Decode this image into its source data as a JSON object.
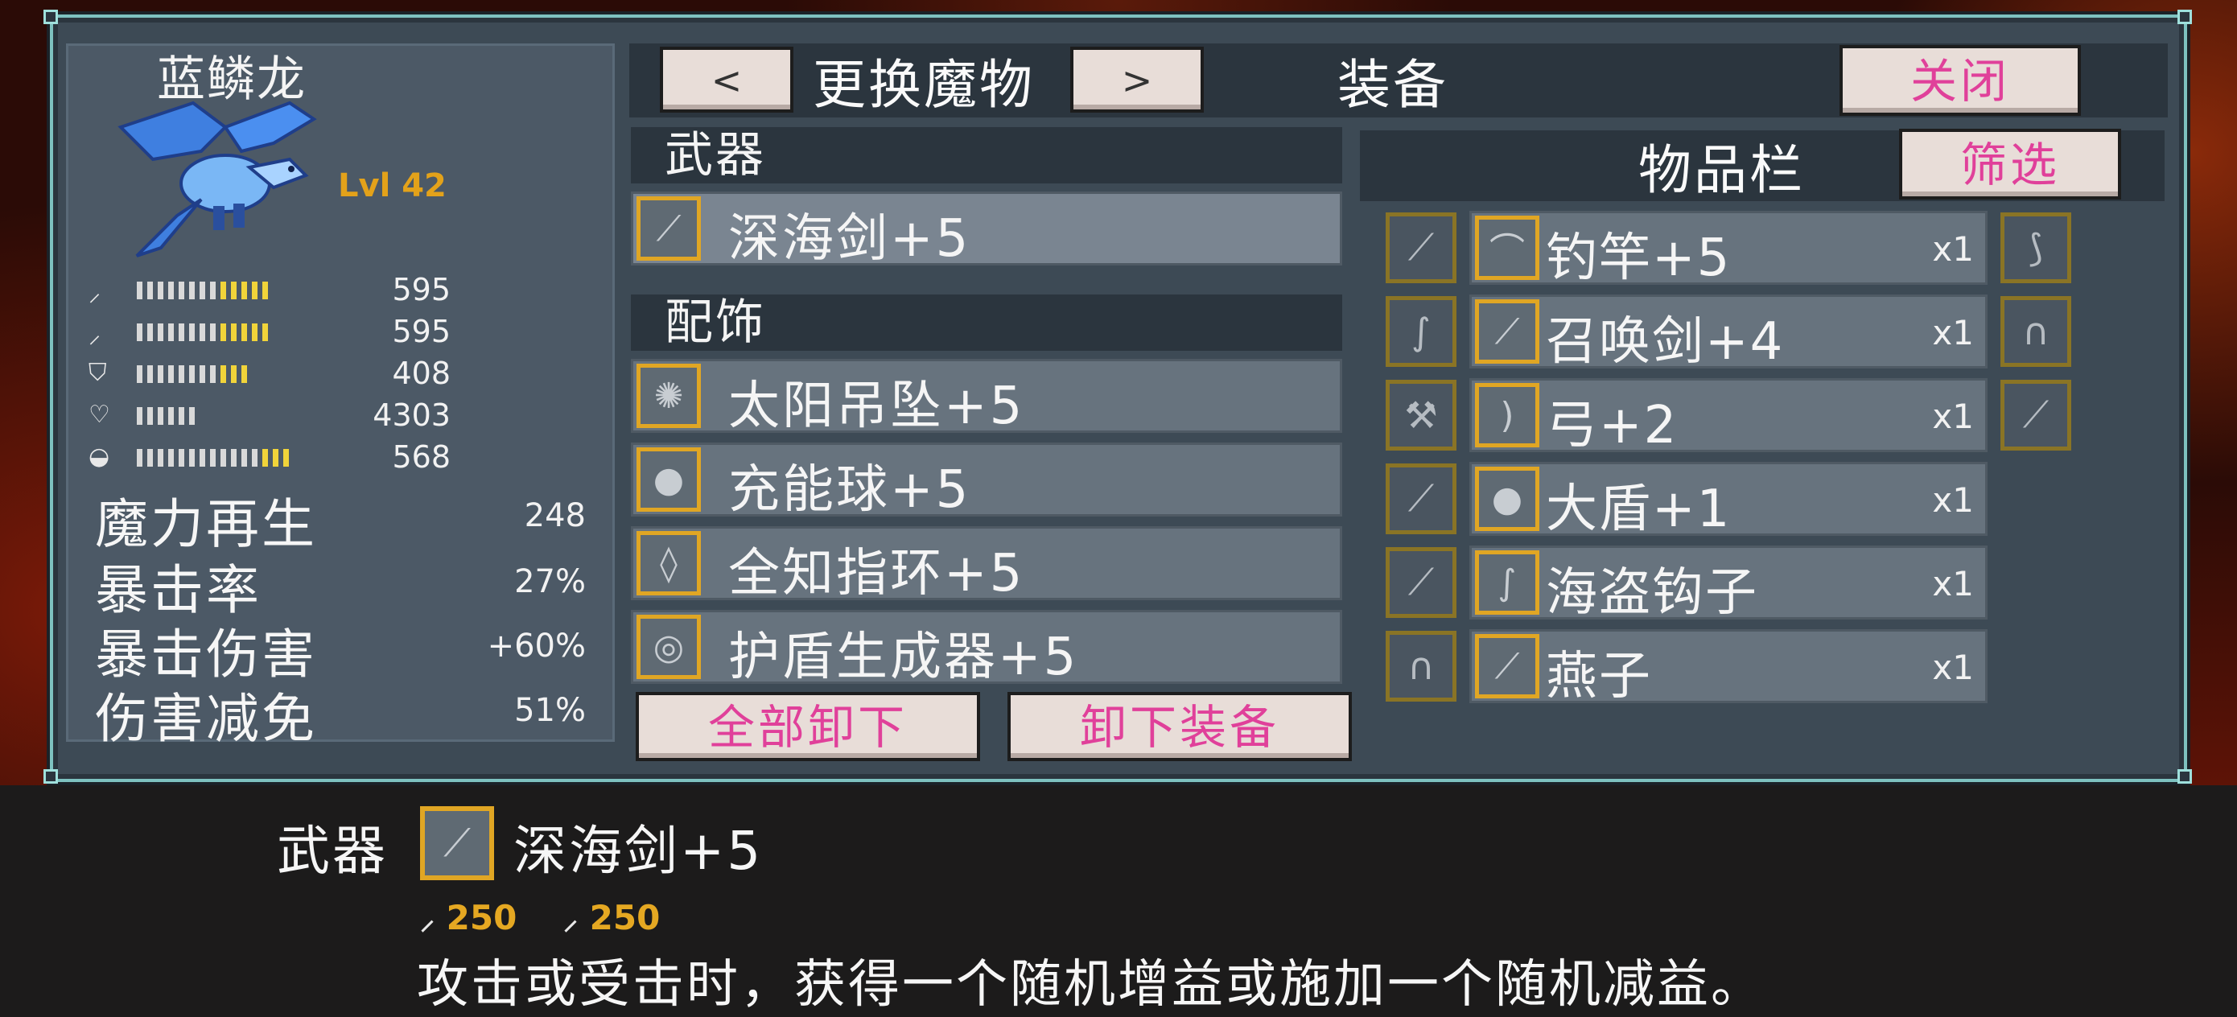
{
  "monster": {
    "name": "蓝鳞龙",
    "level": "Lvl 42",
    "stats": [
      {
        "icon": "sword-icon",
        "glyph": "⸝",
        "value": "595",
        "white": 8,
        "yellow": 5
      },
      {
        "icon": "staff-icon",
        "glyph": "⸝",
        "value": "595",
        "white": 8,
        "yellow": 5
      },
      {
        "icon": "shield-icon",
        "glyph": "⛉",
        "value": "408",
        "white": 8,
        "yellow": 3
      },
      {
        "icon": "heart-icon",
        "glyph": "♡",
        "value": "4303",
        "white": 6,
        "yellow": 0
      },
      {
        "icon": "mana-icon",
        "glyph": "◒",
        "value": "568",
        "white": 12,
        "yellow": 3
      }
    ],
    "secondary": [
      {
        "label": "魔力再生",
        "value": "248"
      },
      {
        "label": "暴击率",
        "value": "27%"
      },
      {
        "label": "暴击伤害",
        "value": "+60%"
      },
      {
        "label": "伤害减免",
        "value": "51%"
      }
    ]
  },
  "header": {
    "prev_label": "<",
    "change_label": "更换魔物",
    "next_label": ">",
    "equip_title": "装备",
    "close_label": "关闭"
  },
  "weapon": {
    "section": "武器",
    "item": {
      "name": "深海剑+5",
      "icon": "sword-icon",
      "glyph": "⟋"
    }
  },
  "accessories": {
    "section": "配饰",
    "items": [
      {
        "name": "太阳吊坠+5",
        "icon": "sun-pendant-icon",
        "glyph": "✺"
      },
      {
        "name": "充能球+5",
        "icon": "orb-icon",
        "glyph": "●"
      },
      {
        "name": "全知指环+5",
        "icon": "ring-icon",
        "glyph": "◊"
      },
      {
        "name": "护盾生成器+5",
        "icon": "shield-generator-icon",
        "glyph": "◎"
      }
    ]
  },
  "actions": {
    "unequip_all": "全部卸下",
    "unequip": "卸下装备"
  },
  "inventory": {
    "title": "物品栏",
    "filter_label": "筛选",
    "left_column": [
      {
        "icon": "mace-icon",
        "glyph": "⟋"
      },
      {
        "icon": "hook-icon",
        "glyph": "∫"
      },
      {
        "icon": "hammer-icon",
        "glyph": "⚒"
      },
      {
        "icon": "wand-icon",
        "glyph": "⟋"
      },
      {
        "icon": "dagger-icon",
        "glyph": "⟋"
      },
      {
        "icon": "horseshoe-icon",
        "glyph": "∩"
      }
    ],
    "rows": [
      {
        "name": "钓竿+5",
        "qty": "x1",
        "icon": "fishing-rod-icon",
        "glyph": "⌒"
      },
      {
        "name": "召唤剑+4",
        "qty": "x1",
        "icon": "summon-sword-icon",
        "glyph": "⟋"
      },
      {
        "name": "弓+2",
        "qty": "x1",
        "icon": "bow-icon",
        "glyph": ")"
      },
      {
        "name": "大盾+1",
        "qty": "x1",
        "icon": "large-shield-icon",
        "glyph": "●"
      },
      {
        "name": "海盗钩子",
        "qty": "x1",
        "icon": "pirate-hook-icon",
        "glyph": "∫"
      },
      {
        "name": "燕子",
        "qty": "x1",
        "icon": "swallow-icon",
        "glyph": "⟋"
      }
    ],
    "right_column": [
      {
        "icon": "scythe-icon",
        "glyph": "⟆"
      },
      {
        "icon": "horseshoe-icon",
        "glyph": "∩"
      },
      {
        "icon": "mace-icon",
        "glyph": "⟋"
      }
    ]
  },
  "info": {
    "label": "武器",
    "item_name": "深海剑+5",
    "stat_physical": "250",
    "stat_magic": "250",
    "description": "攻击或受击时，获得一个随机增益或施加一个随机减益。"
  }
}
